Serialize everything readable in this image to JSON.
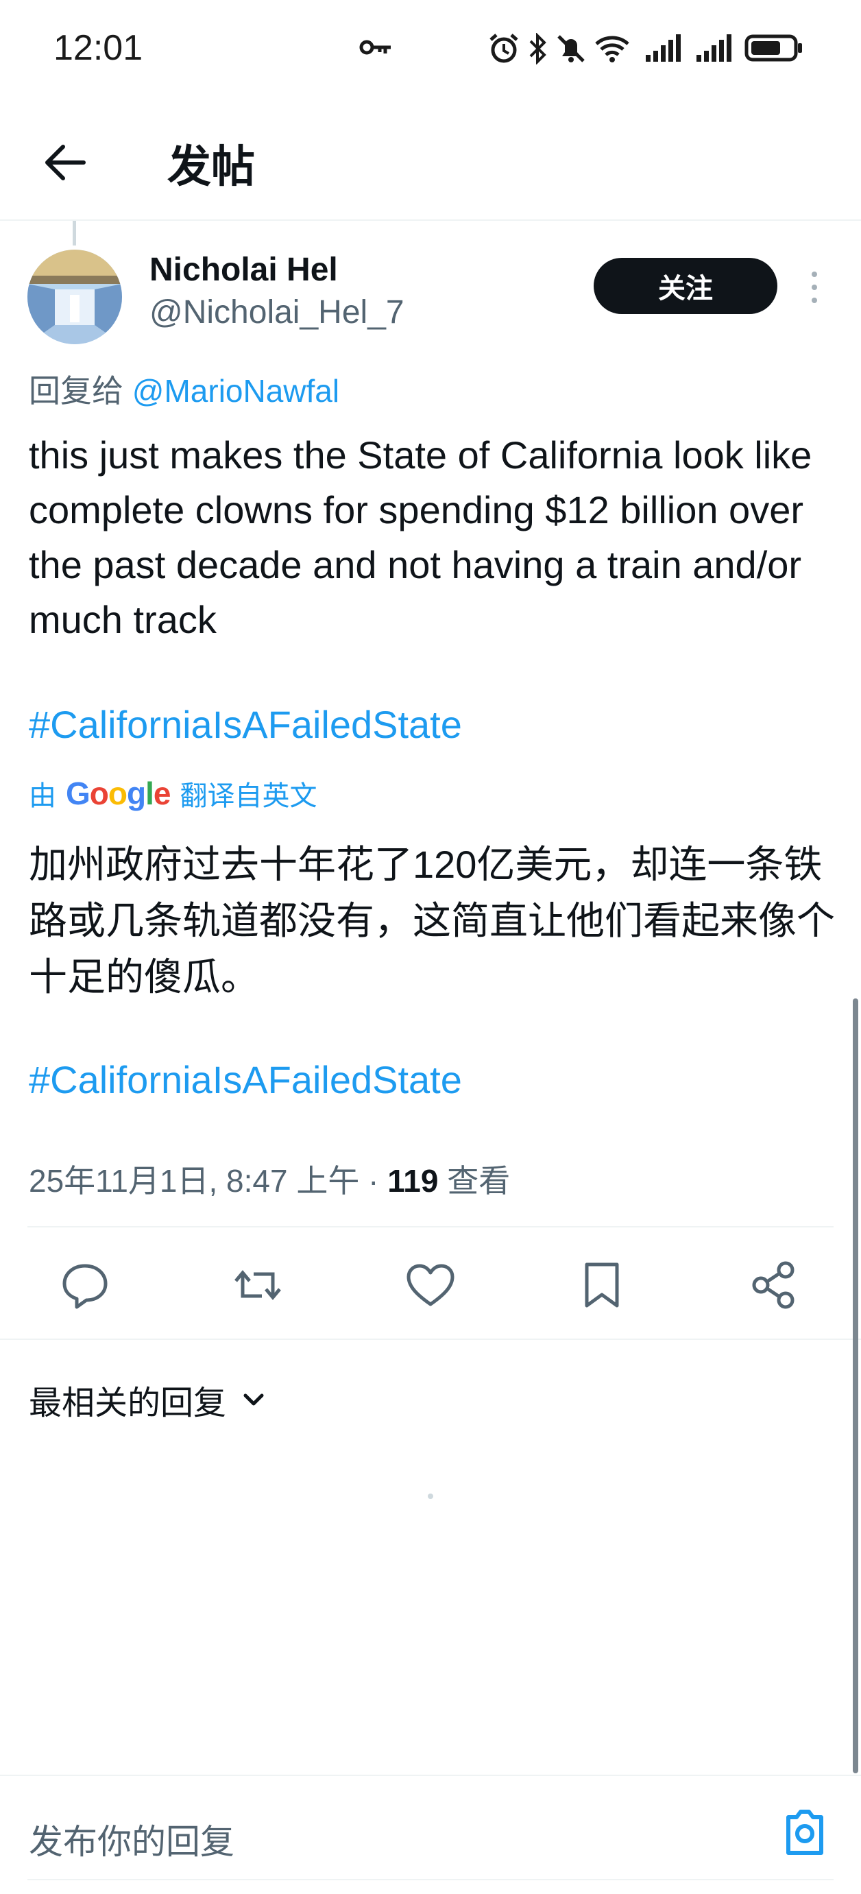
{
  "status_bar": {
    "time": "12:01"
  },
  "nav": {
    "title": "发帖"
  },
  "tweet": {
    "author_name": "Nicholai Hel",
    "author_handle": "@Nicholai_Hel_7",
    "follow_label": "关注",
    "reply_to_prefix": "回复给",
    "reply_to_mention": "@MarioNawfal",
    "text": "this just makes the State of California look like complete clowns for spending $12 billion over the past decade and not having a train and/or much track",
    "hashtag": "#CaliforniaIsAFailedState",
    "translated_by_prefix": "由",
    "translated_by_brand": "Google",
    "translated_by_suffix": "翻译自英文",
    "translation": "加州政府过去十年花了120亿美元，却连一条铁路或几条轨道都没有，这简直让他们看起来像个十足的傻瓜。",
    "translation_hashtag": "#CaliforniaIsAFailedState",
    "timestamp": "25年11月1日, 8:47 上午",
    "separator": "·",
    "views_count": "119",
    "views_label": "查看"
  },
  "actions": [
    "reply-icon",
    "retweet-icon",
    "like-icon",
    "bookmark-icon",
    "share-icon"
  ],
  "replies": {
    "sort_label": "最相关的回复"
  },
  "composer": {
    "placeholder": "发布你的回复"
  },
  "colors": {
    "accent": "#1d9bf0",
    "text": "#0f1419",
    "muted": "#536471",
    "divider": "#eff3f4"
  }
}
